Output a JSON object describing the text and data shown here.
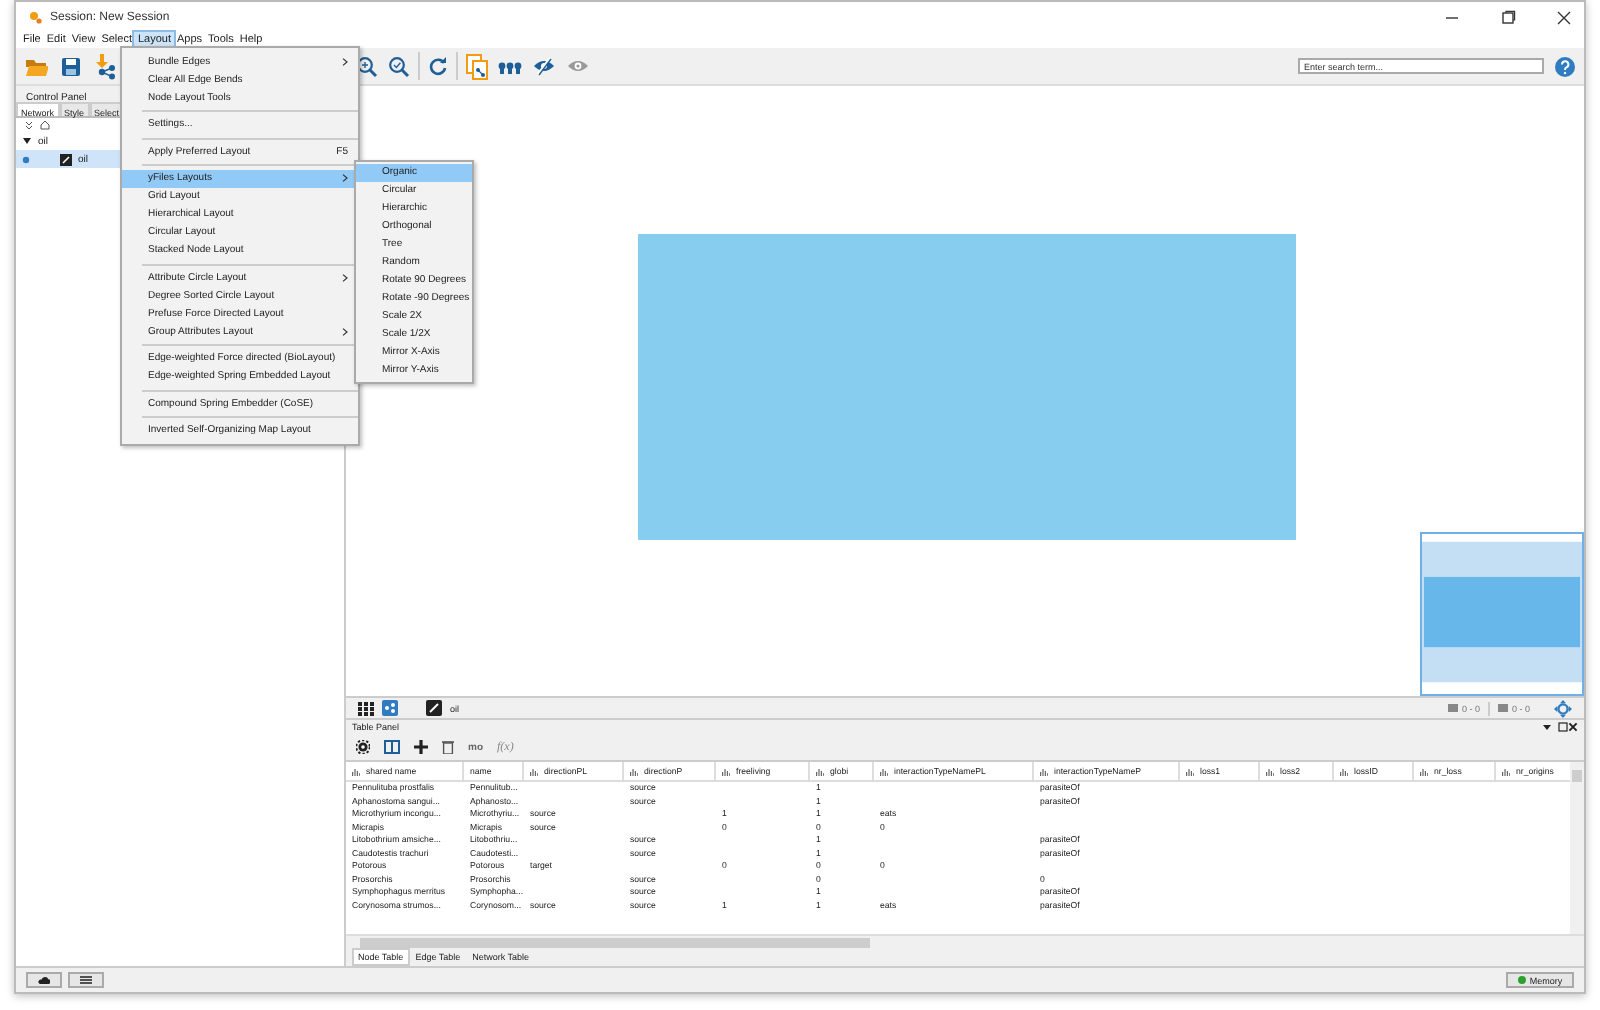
{
  "window": {
    "title": "Session: New Session"
  },
  "menu_bar": [
    {
      "label": "File",
      "selected": false
    },
    {
      "label": "Edit",
      "selected": false
    },
    {
      "label": "View",
      "selected": false
    },
    {
      "label": "Select",
      "selected": false
    },
    {
      "label": "Layout",
      "selected": true
    },
    {
      "label": "Apps",
      "selected": false
    },
    {
      "label": "Tools",
      "selected": false
    },
    {
      "label": "Help",
      "selected": false
    }
  ],
  "layout_menu": {
    "sections": [
      {
        "items": [
          {
            "label": "Bundle Edges",
            "submenu": true,
            "selected": false
          },
          {
            "label": "Clear All Edge Bends",
            "submenu": false,
            "selected": false
          },
          {
            "label": "Node Layout Tools",
            "submenu": false,
            "selected": false
          }
        ]
      },
      {
        "items": [
          {
            "label": "Settings...",
            "submenu": false,
            "selected": false
          }
        ]
      },
      {
        "items": [
          {
            "label": "Apply Preferred Layout",
            "shortcut": "F5",
            "submenu": false,
            "selected": false
          }
        ]
      },
      {
        "items": [
          {
            "label": "yFiles Layouts",
            "submenu": true,
            "selected": true
          },
          {
            "label": "Grid Layout",
            "submenu": false,
            "selected": false
          },
          {
            "label": "Hierarchical Layout",
            "submenu": false,
            "selected": false
          },
          {
            "label": "Circular Layout",
            "submenu": false,
            "selected": false
          },
          {
            "label": "Stacked Node Layout",
            "submenu": false,
            "selected": false
          }
        ]
      },
      {
        "items": [
          {
            "label": "Attribute Circle Layout",
            "submenu": true,
            "selected": false
          },
          {
            "label": "Degree Sorted Circle Layout",
            "submenu": false,
            "selected": false
          },
          {
            "label": "Prefuse Force Directed Layout",
            "submenu": false,
            "selected": false
          },
          {
            "label": "Group Attributes Layout",
            "submenu": true,
            "selected": false
          }
        ]
      },
      {
        "items": [
          {
            "label": "Edge-weighted Force directed (BioLayout)",
            "submenu": false,
            "selected": false
          },
          {
            "label": "Edge-weighted Spring Embedded Layout",
            "submenu": false,
            "selected": false
          }
        ]
      },
      {
        "items": [
          {
            "label": "Compound Spring Embedder (CoSE)",
            "submenu": false,
            "selected": false
          }
        ]
      },
      {
        "items": [
          {
            "label": "Inverted Self-Organizing Map Layout",
            "submenu": false,
            "selected": false
          }
        ]
      }
    ]
  },
  "yfiles_submenu": [
    {
      "label": "Organic",
      "selected": true
    },
    {
      "label": "Circular",
      "selected": false
    },
    {
      "label": "Hierarchic",
      "selected": false
    },
    {
      "label": "Orthogonal",
      "selected": false
    },
    {
      "label": "Tree",
      "selected": false
    },
    {
      "label": "Random",
      "selected": false
    },
    {
      "label": "Rotate 90 Degrees",
      "selected": false
    },
    {
      "label": "Rotate -90 Degrees",
      "selected": false
    },
    {
      "label": "Scale 2X",
      "selected": false
    },
    {
      "label": "Scale 1/2X",
      "selected": false
    },
    {
      "label": "Mirror X-Axis",
      "selected": false
    },
    {
      "label": "Mirror Y-Axis",
      "selected": false
    }
  ],
  "control_panel": {
    "title": "Control Panel",
    "tabs": [
      {
        "label": "Network",
        "selected": true
      },
      {
        "label": "Style",
        "selected": false
      },
      {
        "label": "Select",
        "selected": false
      }
    ],
    "tree": [
      {
        "label": "oil",
        "expanded": true,
        "children": [
          {
            "label": "oil",
            "selected": true
          }
        ]
      }
    ]
  },
  "search": {
    "placeholder": "Enter search term..."
  },
  "network_toolbar": {
    "network_name": "oil",
    "counts": [
      "0 - 0",
      "0 - 0"
    ]
  },
  "table_panel": {
    "title": "Table Panel",
    "tool_text": "mo",
    "function_button": "f(x)",
    "columns": [
      {
        "label": "shared name",
        "kind": "icon"
      },
      {
        "label": "name",
        "kind": "plain"
      },
      {
        "label": "directionPL",
        "kind": "icon"
      },
      {
        "label": "directionP",
        "kind": "icon"
      },
      {
        "label": "freeliving",
        "kind": "icon"
      },
      {
        "label": "globi",
        "kind": "icon"
      },
      {
        "label": "interactionTypeNamePL",
        "kind": "icon"
      },
      {
        "label": "interactionTypeNameP",
        "kind": "icon"
      },
      {
        "label": "loss1",
        "kind": "icon"
      },
      {
        "label": "loss2",
        "kind": "icon"
      },
      {
        "label": "lossID",
        "kind": "icon"
      },
      {
        "label": "nr_loss",
        "kind": "icon"
      },
      {
        "label": "nr_origins",
        "kind": "icon"
      }
    ],
    "rows": [
      [
        "Pennulituba prostfalis",
        "Pennulitub...",
        null,
        "source",
        null,
        "1",
        null,
        "parasiteOf"
      ],
      [
        "Aphanostoma sangui...",
        "Aphanosto...",
        null,
        "source",
        null,
        "1",
        null,
        "parasiteOf"
      ],
      [
        "Microthyrium incongu...",
        "Microthyriu...",
        "source",
        null,
        "1",
        "1",
        "eats",
        null
      ],
      [
        "Micrapis",
        "Micrapis",
        "source",
        null,
        "0",
        "0",
        "0",
        null
      ],
      [
        "Litobothrium amsiche...",
        "Litobothriu...",
        null,
        "source",
        null,
        "1",
        null,
        "parasiteOf"
      ],
      [
        "Caudotestis trachuri",
        "Caudotesti...",
        null,
        "source",
        null,
        "1",
        null,
        "parasiteOf"
      ],
      [
        "Potorous",
        "Potorous",
        "target",
        null,
        "0",
        "0",
        "0",
        null
      ],
      [
        "Prosorchis",
        "Prosorchis",
        null,
        "source",
        null,
        "0",
        null,
        "0"
      ],
      [
        "Symphophagus merritus",
        "Symphopha...",
        null,
        "source",
        null,
        "1",
        null,
        "parasiteOf"
      ],
      [
        "Corynosoma strumos...",
        "Corynosom...",
        "source",
        "source",
        "1",
        "1",
        "eats",
        "parasiteOf"
      ]
    ],
    "tabs": [
      {
        "label": "Node Table",
        "selected": true
      },
      {
        "label": "Edge Table",
        "selected": false
      },
      {
        "label": "Network Table",
        "selected": false
      }
    ]
  },
  "status_bar": {
    "memory": "Memory"
  }
}
